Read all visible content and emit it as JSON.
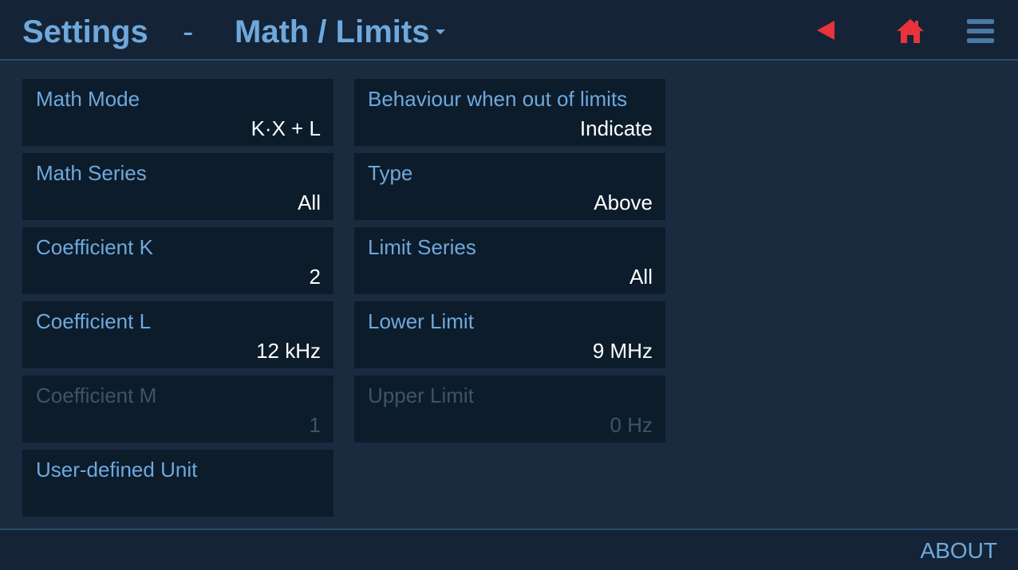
{
  "header": {
    "title": "Settings",
    "separator": "-",
    "page": "Math / Limits",
    "icons": {
      "back": "back-arrow-icon",
      "home": "home-icon",
      "menu": "hamburger-menu-icon"
    },
    "colors": {
      "accent": "#6fa8dc",
      "nav_red": "#e8333c"
    }
  },
  "left_column": [
    {
      "label": "Math Mode",
      "value": "K·X + L",
      "enabled": true
    },
    {
      "label": "Math Series",
      "value": "All",
      "enabled": true
    },
    {
      "label": "Coefficient K",
      "value": "2",
      "enabled": true
    },
    {
      "label": "Coefficient L",
      "value": "12 kHz",
      "enabled": true
    },
    {
      "label": "Coefficient M",
      "value": "1",
      "enabled": false
    },
    {
      "label": "User-defined Unit",
      "value": "",
      "enabled": true
    }
  ],
  "right_column": [
    {
      "label": "Behaviour when out of limits",
      "value": "Indicate",
      "enabled": true
    },
    {
      "label": "Type",
      "value": "Above",
      "enabled": true
    },
    {
      "label": "Limit Series",
      "value": "All",
      "enabled": true
    },
    {
      "label": "Lower Limit",
      "value": "9 MHz",
      "enabled": true
    },
    {
      "label": "Upper Limit",
      "value": "0 Hz",
      "enabled": false
    }
  ],
  "footer": {
    "about": "ABOUT"
  }
}
